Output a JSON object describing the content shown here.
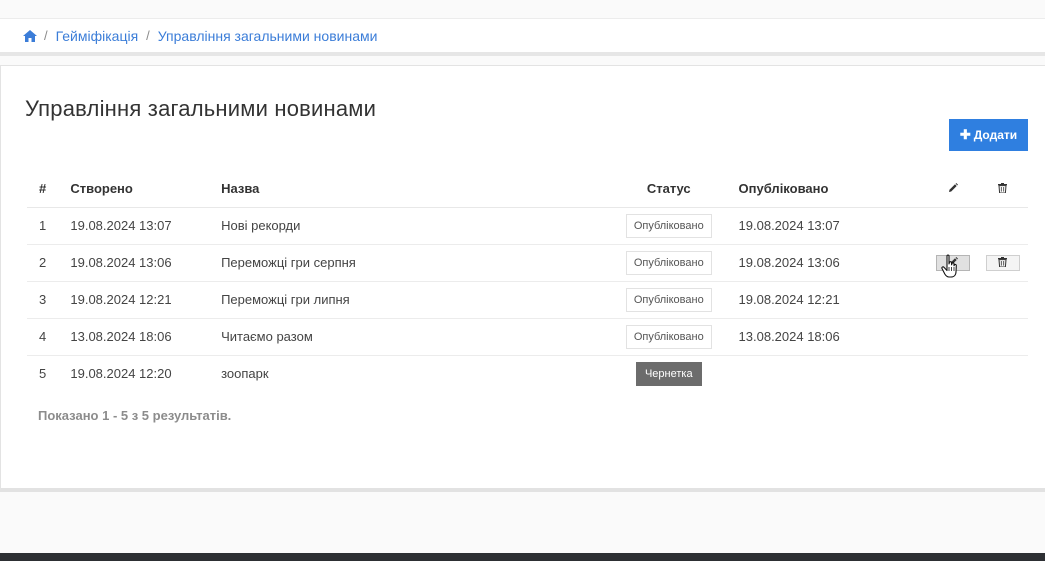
{
  "breadcrumb": {
    "items": [
      "Гейміфікація",
      "Управління загальними новинами"
    ]
  },
  "page": {
    "title": "Управління загальними новинами",
    "add_label": "Додати"
  },
  "table": {
    "headers": {
      "num": "#",
      "created": "Створено",
      "name": "Назва",
      "status": "Статус",
      "published": "Опубліковано"
    },
    "rows": [
      {
        "num": "1",
        "created": "19.08.2024 13:07",
        "name": "Нові рекорди",
        "status": "Опубліковано",
        "published": "19.08.2024 13:07"
      },
      {
        "num": "2",
        "created": "19.08.2024 13:06",
        "name": "Переможці гри серпня",
        "status": "Опубліковано",
        "published": "19.08.2024 13:06"
      },
      {
        "num": "3",
        "created": "19.08.2024 12:21",
        "name": "Переможці гри липня",
        "status": "Опубліковано",
        "published": "19.08.2024 12:21"
      },
      {
        "num": "4",
        "created": "13.08.2024 18:06",
        "name": "Читаємо разом",
        "status": "Опубліковано",
        "published": "13.08.2024 18:06"
      },
      {
        "num": "5",
        "created": "19.08.2024 12:20",
        "name": "зоопарк",
        "status": "Чернетка",
        "published": ""
      }
    ]
  },
  "summary": "Показано 1 - 5 з 5 результатів.",
  "icons": {
    "home": "home-icon",
    "edit": "pencil-icon",
    "delete": "trash-icon",
    "cursor": "hand-pointer-icon"
  },
  "colors": {
    "accent": "#2f7fe0",
    "link": "#3b7dd8",
    "draft_badge": "#6c6c6c",
    "footer": "#2d2f33"
  }
}
